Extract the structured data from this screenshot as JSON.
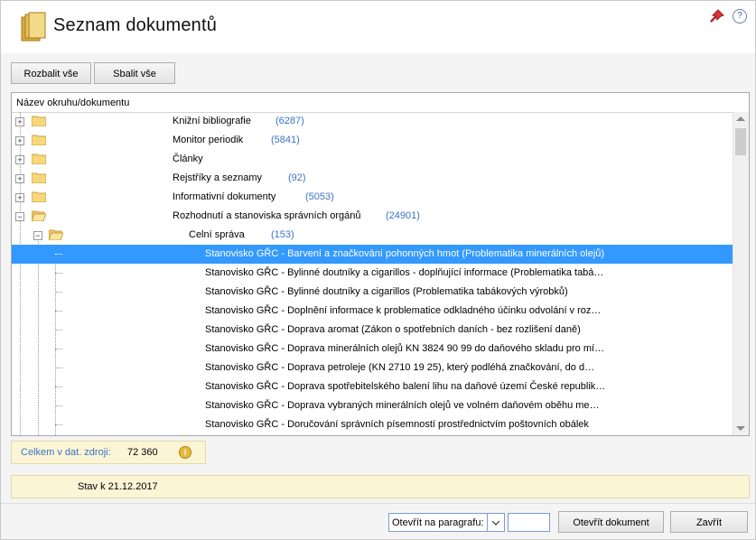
{
  "window": {
    "title": "Seznam  dokumentů"
  },
  "toolbar": {
    "expand_label": "Rozbalit vše",
    "collapse_label": "Sbalit vše"
  },
  "tree": {
    "column_header": "Název okruhu/dokumentu",
    "groups": [
      {
        "label": "Knižní bibliografie",
        "count": "(6287)"
      },
      {
        "label": "Monitor periodik",
        "count": "(5841)"
      },
      {
        "label": "Články",
        "count": ""
      },
      {
        "label": "Rejstříky a seznamy",
        "count": "(92)"
      },
      {
        "label": "Informativní dokumenty",
        "count": "(5053)"
      },
      {
        "label": "Rozhodnutí a stanoviska správních orgánů",
        "count": "(24901)"
      }
    ],
    "subgroup": {
      "label": "Celní správa",
      "count": "(153)"
    },
    "documents": [
      "Stanovisko GŘC - Barvení a značkování pohonných hmot (Problematika minerálních olejů)",
      "Stanovisko GŘC - Bylinné doutníky a cigarillos - doplňující informace (Problematika tabá…",
      "Stanovisko GŘC - Bylinné doutníky a cigarillos (Problematika tabákových výrobků)",
      "Stanovisko GŘC - Doplnění informace k problematice odkladného účinku odvolání v roz…",
      "Stanovisko GŘC - Doprava aromat (Zákon o spotřebních daních - bez rozlišení daně)",
      "Stanovisko GŘC - Doprava minerálních olejů KN 3824 90 99 do daňového skladu pro mí…",
      "Stanovisko GŘC - Doprava petroleje (KN 2710 19 25), který podléhá značkování, do d…",
      "Stanovisko GŘC - Doprava spotřebitelského balení lihu na daňové území České republik…",
      "Stanovisko GŘC - Doprava vybraných minerálních olejů ve volném daňovém oběhu me…",
      "Stanovisko GŘC - Doručování správních písemností prostřednictvím poštovních obálek"
    ]
  },
  "summary": {
    "total_label": "Celkem v dat. zdroji:",
    "total_value": "72 360"
  },
  "status": {
    "text": "Stav k 21.12.2017"
  },
  "footer": {
    "paragraph_select": "Otevřít na paragrafu:",
    "open_label": "Otevřít dokument",
    "close_label": "Zavřít"
  },
  "colors": {
    "selection": "#3399ff",
    "count_text": "#3b73c4",
    "info_panel": "#fbf5d6"
  }
}
